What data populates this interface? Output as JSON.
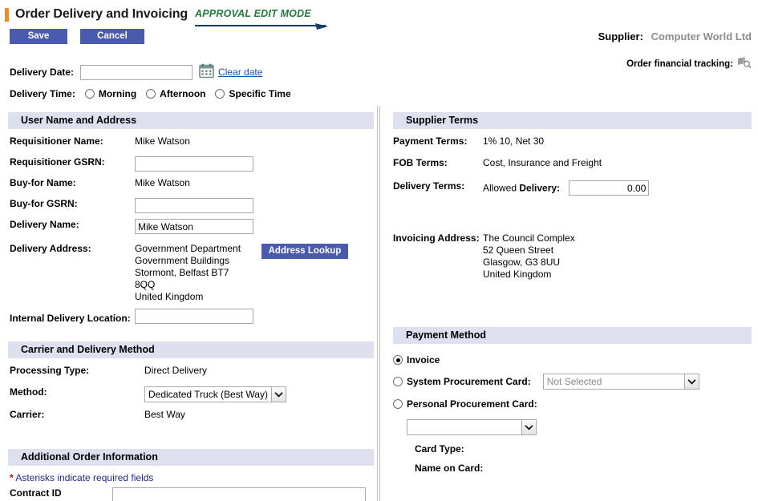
{
  "header": {
    "title": "Order Delivery and Invoicing",
    "mode_badge": "APPROVAL EDIT MODE",
    "save_label": "Save",
    "cancel_label": "Cancel",
    "supplier_label": "Supplier:",
    "supplier_value": "Computer World Ltd",
    "tracking_label": "Order financial tracking:",
    "tracking_icon": "document-search-icon"
  },
  "delivery": {
    "date_label": "Delivery Date:",
    "date_value": "",
    "date_placeholder": "",
    "calendar_icon": "calendar-icon",
    "clear_date_label": "Clear date",
    "time_label": "Delivery Time:",
    "time_options": [
      {
        "label": "Morning",
        "selected": false
      },
      {
        "label": "Afternoon",
        "selected": false
      },
      {
        "label": "Specific Time",
        "selected": false
      }
    ]
  },
  "user_address": {
    "heading": "User Name and Address",
    "requisitioner_name_label": "Requisitioner Name:",
    "requisitioner_name_value": "Mike Watson",
    "requisitioner_gsrn_label": "Requisitioner GSRN:",
    "requisitioner_gsrn_value": "",
    "buy_for_name_label": "Buy-for Name:",
    "buy_for_name_value": "Mike Watson",
    "buy_for_gsrn_label": "Buy-for GSRN:",
    "buy_for_gsrn_value": "",
    "delivery_name_label": "Delivery Name:",
    "delivery_name_value": "Mike Watson",
    "delivery_address_label": "Delivery Address:",
    "delivery_address_lines": [
      "Government Department",
      "Government Buildings",
      "Stormont, Belfast BT7",
      "8QQ",
      "United Kingdom"
    ],
    "address_lookup_label": "Address Lookup",
    "internal_location_label": "Internal Delivery Location:",
    "internal_location_value": ""
  },
  "supplier_terms": {
    "heading": "Supplier Terms",
    "payment_terms_label": "Payment Terms:",
    "payment_terms_value": "1% 10, Net 30",
    "fob_terms_label": "FOB Terms:",
    "fob_terms_value": "Cost, Insurance and Freight",
    "delivery_terms_label": "Delivery Terms:",
    "allowed_delivery_label_prefix": "Allowed ",
    "allowed_delivery_label_bold": "Delivery:",
    "allowed_delivery_value": "0.00",
    "invoicing_address_label": "Invoicing Address:",
    "invoicing_address_lines": [
      "The Council Complex",
      "52 Queen Street",
      "Glasgow, G3 8UU",
      "United Kingdom"
    ]
  },
  "carrier": {
    "heading": "Carrier and Delivery Method",
    "processing_type_label": "Processing Type:",
    "processing_type_value": "Direct Delivery",
    "method_label": "Method:",
    "method_value": "Dedicated Truck (Best Way)",
    "carrier_label": "Carrier:",
    "carrier_value": "Best Way"
  },
  "payment_method": {
    "heading": "Payment Method",
    "invoice_label": "Invoice",
    "invoice_selected": true,
    "system_card_label": "System Procurement Card:",
    "system_card_selected": false,
    "system_card_value": "Not Selected",
    "personal_card_label": "Personal Procurement Card:",
    "personal_card_selected": false,
    "personal_card_value": "",
    "card_type_label": "Card Type:",
    "card_type_value": "",
    "name_on_card_label": "Name on Card:",
    "name_on_card_value": ""
  },
  "additional": {
    "heading": "Additional Order Information",
    "required_note_star": "*",
    "required_note": "Asterisks indicate required fields",
    "contract_id_label": "Contract ID",
    "contract_id_value": ""
  },
  "colors": {
    "accent_orange": "#ef8b1f",
    "button_blue": "#4a5aad",
    "section_header_bg": "#dde0ef",
    "approval_green": "#227a3b",
    "link_blue": "#1a4fb4",
    "required_red": "#cc0000",
    "note_navy": "#1f2a8c"
  }
}
